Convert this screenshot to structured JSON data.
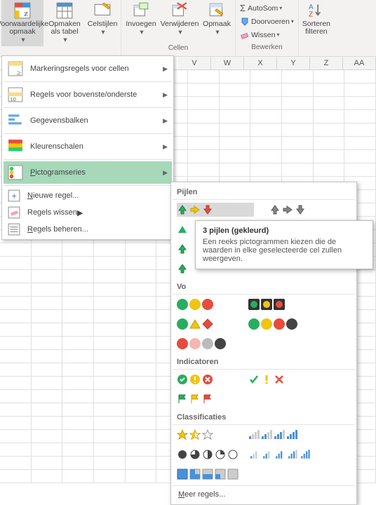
{
  "ribbon": {
    "cond_format": "Voorwaardelijke opmaak",
    "format_table": "Opmaken als tabel",
    "cell_styles": "Celstijlen",
    "insert": "Invoegen",
    "delete": "Verwijderen",
    "format": "Opmaak",
    "cells_group": "Cellen",
    "autosum": "AutoSom",
    "fill": "Doorvoeren",
    "clear": "Wissen",
    "sort_filter": "Sorteren filteren",
    "edit_group": "Bewerken"
  },
  "columns": [
    "V",
    "W",
    "X",
    "Y",
    "Z",
    "AA"
  ],
  "menu": {
    "highlight": "Markeringsregels voor cellen",
    "topbottom": "Regels voor bovenste/onderste",
    "databars": "Gegevensbalken",
    "colorscales": "Kleurenschalen",
    "iconsets": "Pictogramseries",
    "newrule": "Nieuwe regel...",
    "clear": "Regels wissen",
    "manage": "Regels beheren..."
  },
  "submenu": {
    "arrows": "Pijlen",
    "shapes": "Vormen",
    "indicators": "Indicatoren",
    "ratings": "Classificaties",
    "more": "Meer regels..."
  },
  "tooltip": {
    "title": "3 pijlen (gekleurd)",
    "body": "Een reeks pictogrammen kiezen die de waarden in elke geselecteerde cel zullen weergeven."
  }
}
